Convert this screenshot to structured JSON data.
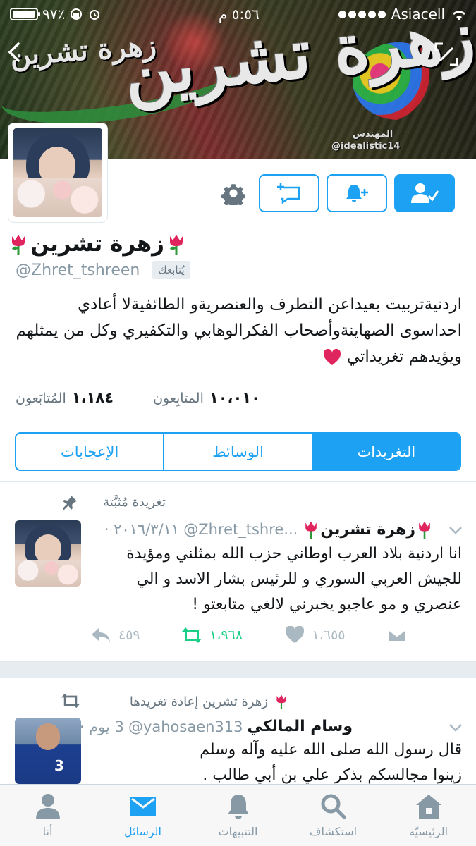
{
  "status_bar": {
    "carrier": "Asiacell",
    "time": "٥:٥٦ م",
    "battery_percent": "٩٧٪",
    "battery_level": 0.97
  },
  "banner": {
    "script_large": "زهرة تشرين",
    "script_small": "زهرة تشرين",
    "credit_line1": "المهندس",
    "credit_line2": "@idealistic14"
  },
  "profile": {
    "name": "زهرة تشرين",
    "handle": "@Zhret_tshreen",
    "follows_you_label": "يُتابعك",
    "bio": "اردنيةتربيت بعيداعن التطرف والعنصريةو الطائفيةلا أعادي احداسوى الصهاينةوأصحاب الفكرالوهابي والتكفيري وكل من يمثلهم ويؤيدهم تغريداتي",
    "stats": {
      "following_count": "١٠،٠١٠",
      "following_label": "المتابِعون",
      "followers_count": "١،١٨٤",
      "followers_label": "المُتابَعون"
    }
  },
  "tabs": [
    {
      "label": "الإعجابات",
      "active": false
    },
    {
      "label": "الوسائط",
      "active": false
    },
    {
      "label": "التغريدات",
      "active": true
    }
  ],
  "pinned_tweet": {
    "context_label": "تغريدة مُثبَّتة",
    "name": "زهرة تشرين",
    "handle": "@Zhret_tshre...",
    "date": "٢٠١٦/٣/١١ ·",
    "text": "انا اردنية بلاد العرب اوطاني حزب الله بمثلني ومؤيدة للجيش العربي السوري و للرئيس بشار الاسد و الي عنصري و مو عاجبو يخبرني لالغي متابعتو !",
    "replies": "٤٥٩",
    "retweets": "١،٩٦٨",
    "likes": "١،٦٥٥"
  },
  "retweeted_tweet": {
    "context_label": "زهرة تشرين إعادة تغريدها",
    "name": "وسام المالكي",
    "handle": "@yahosaen313",
    "date": "3 يوم ·",
    "text": "قال رسول الله صلى الله عليه وآله وسلم زينوا مجالسكم بذكر علي بن أبي طالب ."
  },
  "bottom_nav": [
    {
      "label": "الرئيسيّة",
      "icon": "home-icon",
      "active": false
    },
    {
      "label": "استكشاف",
      "icon": "search-icon",
      "active": false
    },
    {
      "label": "التنبيهات",
      "icon": "bell-icon",
      "active": false
    },
    {
      "label": "الرسائل",
      "icon": "mail-icon",
      "active": true
    },
    {
      "label": "أنا",
      "icon": "person-icon",
      "active": false
    }
  ],
  "colors": {
    "accent": "#1da1f2",
    "retweet": "#19cf86",
    "muted": "#8899a6"
  }
}
